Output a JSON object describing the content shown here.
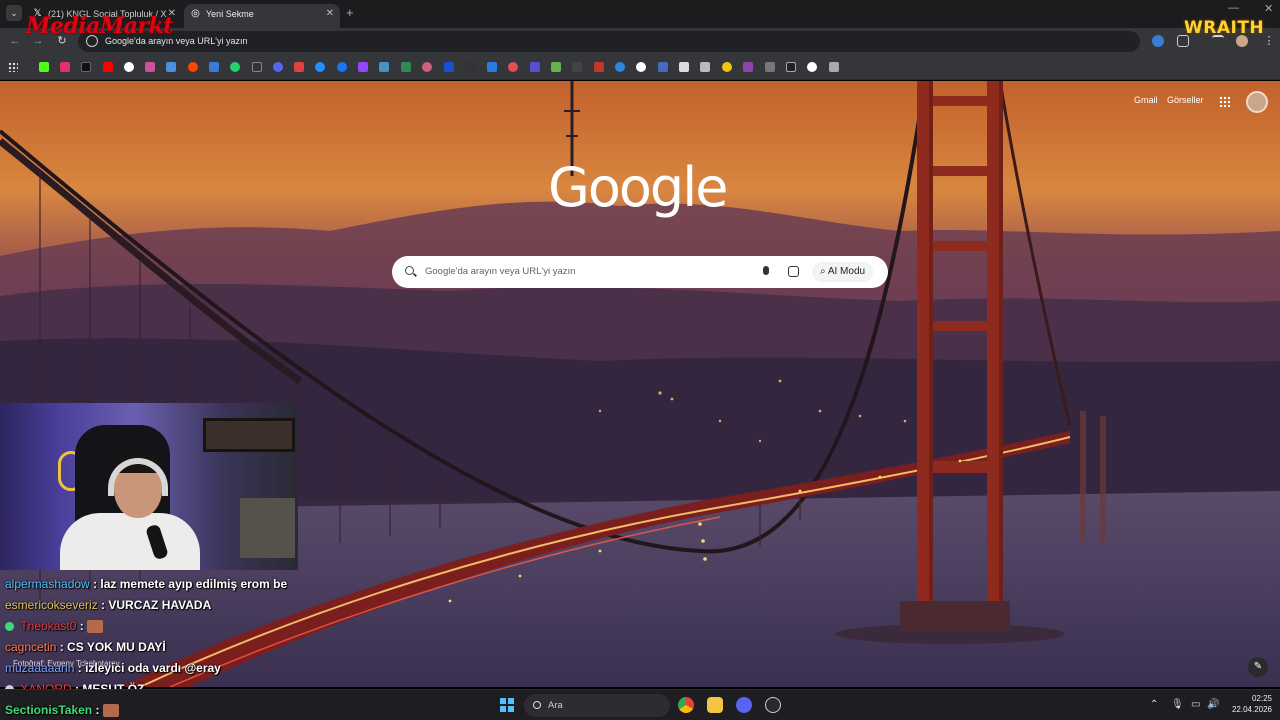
{
  "browser": {
    "tabs": [
      {
        "title": "(21) KNGL Social Topluluk / X",
        "icon": "x-logo-icon",
        "active": false
      },
      {
        "title": "Yeni Sekme",
        "icon": "chrome-icon",
        "active": true
      }
    ],
    "address_bar": {
      "text": "Google'da arayın veya URL'yi yazın"
    }
  },
  "overlay": {
    "brand_logo": "MediaMarkt",
    "sponsor_logo": "WRAITH"
  },
  "newtab": {
    "top_links": {
      "gmail": "Gmail",
      "images": "Görseller"
    },
    "logo_text": "Google",
    "search": {
      "placeholder": "Google'da arayın veya URL'yi yazın",
      "ai_mode": "AI Modu"
    },
    "photo_credit": "Fotoğraf: Evgeny Tchebotarev"
  },
  "chat": [
    {
      "user": "alpermashadow",
      "user_color": "#4fc3ff",
      "message": ": laz memete ayıp edilmiş erom be"
    },
    {
      "user": "esmericokseveriz",
      "user_color": "#e0c060",
      "message": ": VURCAZ HAVADA"
    },
    {
      "user": "Theokast0",
      "user_color": "#e0404a",
      "message": ":",
      "badge": true,
      "emote": true
    },
    {
      "user": "cagncetin",
      "user_color": "#ff7a5a",
      "message": ": CS YOK MU DAYİ"
    },
    {
      "user": "muzaaaaann",
      "user_color": "#7aa0ff",
      "message": ": izleyici oda vardı @eray"
    },
    {
      "user": "XANORD",
      "user_color": "#ff3b3b",
      "message": ": MESUT ÖZ",
      "badge": true
    },
    {
      "user": "SectionisTaken",
      "user_color": "#3ed97a",
      "message": ":",
      "emote": true
    }
  ],
  "taskbar": {
    "search_label": "Ara",
    "time": "02:25",
    "date": "22.04.2026"
  },
  "colors": {
    "accent": "#4cc2ff",
    "brand_red": "#e3000f",
    "wraith_yellow": "#ffd22e"
  }
}
